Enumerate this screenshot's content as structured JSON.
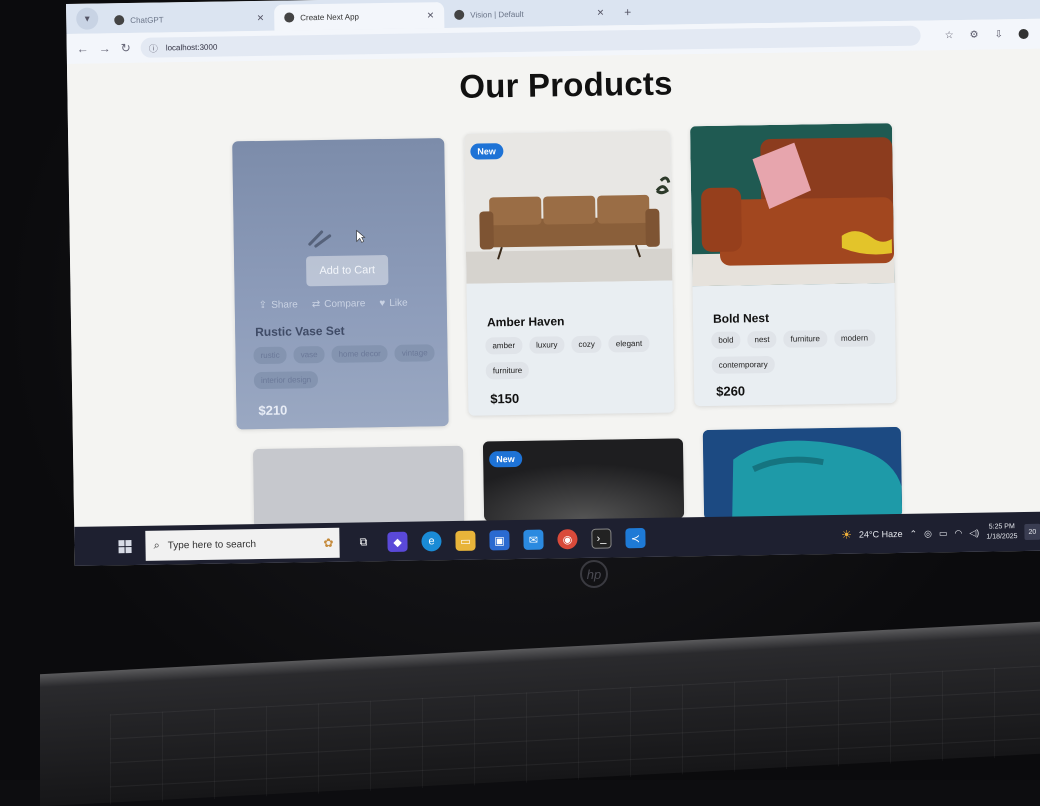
{
  "browser": {
    "tabs": [
      {
        "label": "ChatGPT",
        "active": false
      },
      {
        "label": "Create Next App",
        "active": true
      },
      {
        "label": "Vision | Default",
        "active": false
      }
    ],
    "url": "localhost:3000"
  },
  "page": {
    "title": "Our Products",
    "products": [
      {
        "name": "Rustic Vase Set",
        "price": "$210",
        "tags": [
          "rustic",
          "vase",
          "home decor",
          "vintage",
          "interior design"
        ],
        "badge": "",
        "hover": {
          "add_to_cart": "Add to Cart",
          "share": "Share",
          "compare": "Compare",
          "like": "Like"
        }
      },
      {
        "name": "Amber Haven",
        "price": "$150",
        "tags": [
          "amber",
          "luxury",
          "cozy",
          "elegant",
          "furniture"
        ],
        "badge": "New"
      },
      {
        "name": "Bold Nest",
        "price": "$260",
        "tags": [
          "bold",
          "nest",
          "furniture",
          "modern",
          "contemporary"
        ],
        "badge": ""
      },
      {
        "name": "",
        "badge": ""
      },
      {
        "name": "",
        "badge": "New"
      },
      {
        "name": "",
        "badge": ""
      }
    ]
  },
  "taskbar": {
    "search_placeholder": "Type here to search",
    "weather": "24°C  Haze",
    "time": "5:25 PM",
    "date": "1/18/2025",
    "notifications": "20"
  },
  "colors": {
    "badge": "#1e73d6",
    "taskbar": "#1e2030",
    "tab_strip": "#dbe4f1"
  }
}
